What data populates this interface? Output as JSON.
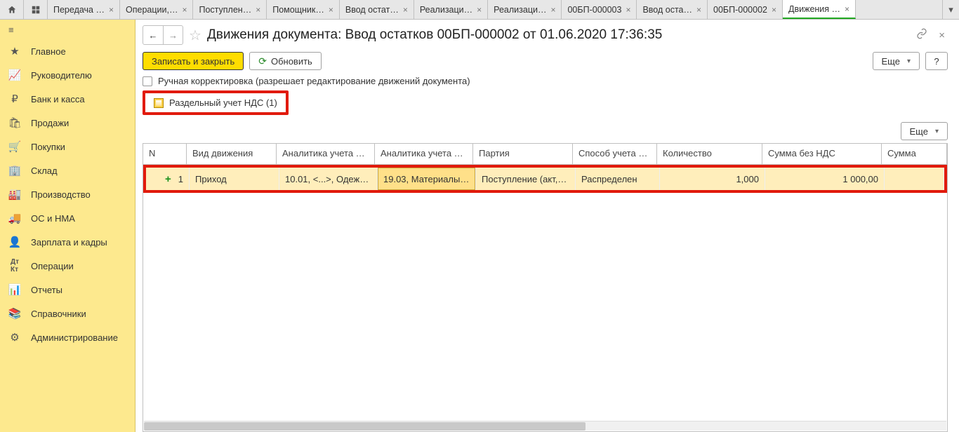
{
  "tabs": [
    {
      "label": "Передача …"
    },
    {
      "label": "Операции,…"
    },
    {
      "label": "Поступлен…"
    },
    {
      "label": "Помощник…"
    },
    {
      "label": "Ввод остат…"
    },
    {
      "label": "Реализаци…"
    },
    {
      "label": "Реализаци…"
    },
    {
      "label": "00БП-000003"
    },
    {
      "label": "Ввод оста…"
    },
    {
      "label": "00БП-000002"
    },
    {
      "label": "Движения …",
      "active": true
    }
  ],
  "nav": [
    {
      "icon": "≡",
      "label": "Главное"
    },
    {
      "icon": "📈",
      "label": "Руководителю"
    },
    {
      "icon": "₽",
      "label": "Банк и касса"
    },
    {
      "icon": "🛍",
      "label": "Продажи"
    },
    {
      "icon": "🛒",
      "label": "Покупки"
    },
    {
      "icon": "🏢",
      "label": "Склад"
    },
    {
      "icon": "🏭",
      "label": "Производство"
    },
    {
      "icon": "🚚",
      "label": "ОС и НМА"
    },
    {
      "icon": "👤",
      "label": "Зарплата и кадры"
    },
    {
      "icon": "ᴬᴷ",
      "label": "Операции"
    },
    {
      "icon": "📊",
      "label": "Отчеты"
    },
    {
      "icon": "📚",
      "label": "Справочники"
    },
    {
      "icon": "⚙",
      "label": "Администрирование"
    }
  ],
  "page_title": "Движения документа: Ввод остатков 00БП-000002 от 01.06.2020 17:36:35",
  "buttons": {
    "save_close": "Записать и закрыть",
    "refresh": "Обновить",
    "more": "Еще",
    "help": "?"
  },
  "manual_edit_label": "Ручная корректировка (разрешает редактирование движений документа)",
  "register_tab": "Раздельный учет НДС (1)",
  "columns": {
    "n": "N",
    "kind": "Вид движения",
    "acc1": "Аналитика учета …",
    "acc2": "Аналитика учета …",
    "party": "Партия",
    "method": "Способ учета …",
    "qty": "Количество",
    "sum": "Сумма без НДС",
    "sum2": "Сумма"
  },
  "row": {
    "n": "1",
    "kind": "Приход",
    "acc1": "10.01, <...>, Одеж…",
    "acc2": "19.03, Материалы…",
    "party": "Поступление (акт,…",
    "method": "Распределен",
    "qty": "1,000",
    "sum": "1 000,00",
    "sum2": ""
  }
}
